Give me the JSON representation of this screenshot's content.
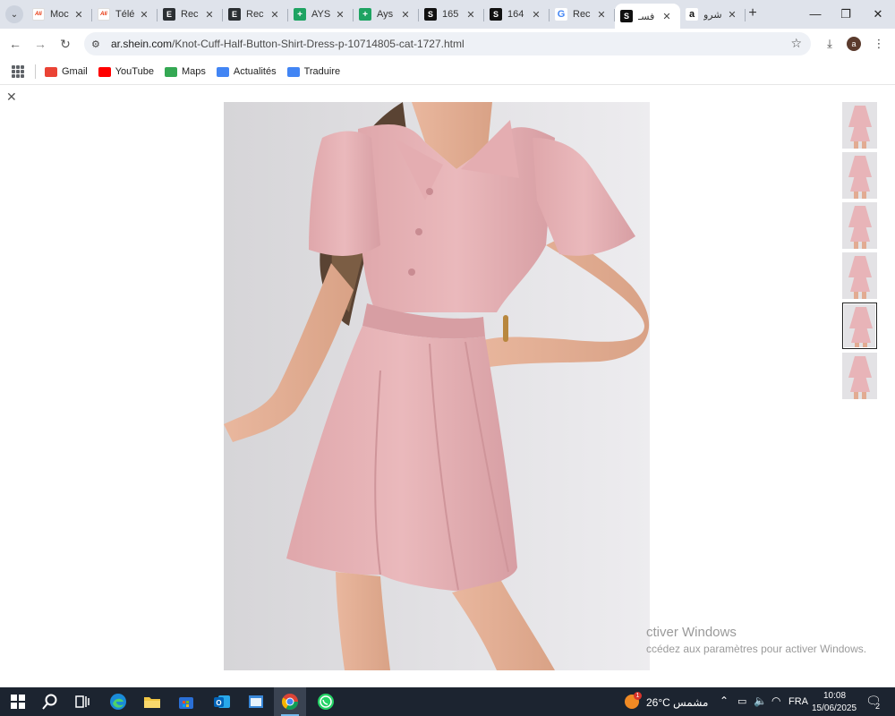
{
  "browser": {
    "tabs": [
      {
        "title": "Moc",
        "favicon": "aliexpress",
        "active": false
      },
      {
        "title": "Télé",
        "favicon": "aliexpress",
        "active": false
      },
      {
        "title": "Rec",
        "favicon": "e-logo",
        "active": false
      },
      {
        "title": "Rec",
        "favicon": "e-logo",
        "active": false
      },
      {
        "title": "AYS",
        "favicon": "google-sheets",
        "active": false
      },
      {
        "title": "Ays",
        "favicon": "google-sheets",
        "active": false
      },
      {
        "title": "165",
        "favicon": "shein-s",
        "active": false
      },
      {
        "title": "164",
        "favicon": "shein-s",
        "active": false
      },
      {
        "title": "Rec",
        "favicon": "google-g",
        "active": false
      },
      {
        "title": "فسـ",
        "favicon": "shein-s",
        "active": true
      },
      {
        "title": "شرو",
        "favicon": "amazon-a",
        "active": false
      }
    ],
    "url_host": "ar.shein.com",
    "url_path": "/Knot-Cuff-Half-Button-Shirt-Dress-p-10714805-cat-1727.html",
    "profile_initial": "a",
    "bookmarks": [
      {
        "label": "Gmail",
        "icon": "gmail-icon",
        "color": "#ea4335"
      },
      {
        "label": "YouTube",
        "icon": "youtube-icon",
        "color": "#ff0000"
      },
      {
        "label": "Maps",
        "icon": "maps-icon",
        "color": "#34a853"
      },
      {
        "label": "Actualités",
        "icon": "news-icon",
        "color": "#4285f4"
      },
      {
        "label": "Traduire",
        "icon": "translate-icon",
        "color": "#4285f4"
      }
    ]
  },
  "viewer": {
    "thumbnail_count": 6,
    "selected_thumbnail": 5,
    "dress_color": "#e8b4b8"
  },
  "watermark": {
    "line1": "ctiver Windows",
    "line2": "ccédez aux paramètres pour activer Windows."
  },
  "taskbar": {
    "weather_temp": "26°C",
    "weather_label": "مشمس",
    "weather_badge": "1",
    "language": "FRA",
    "time": "10:08",
    "date": "15/06/2025",
    "notification_count": "2"
  }
}
